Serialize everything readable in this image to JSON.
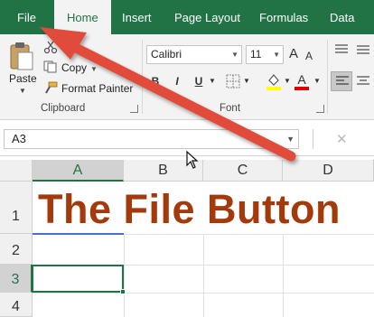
{
  "tabs": {
    "file": "File",
    "home": "Home",
    "insert": "Insert",
    "page_layout": "Page Layout",
    "formulas": "Formulas",
    "data": "Data"
  },
  "clipboard": {
    "paste": "Paste",
    "copy": "Copy",
    "format_painter": "Format Painter",
    "group_label": "Clipboard"
  },
  "font": {
    "name": "Calibri",
    "size": "11",
    "bold": "B",
    "italic": "I",
    "underline": "U",
    "grow": "A",
    "shrink": "A",
    "font_color": "A",
    "group_label": "Font"
  },
  "formula_bar": {
    "name_box": "A3",
    "cancel": "✕"
  },
  "grid": {
    "columns": [
      "A",
      "B",
      "C",
      "D"
    ],
    "rows": [
      "1",
      "2",
      "3",
      "4"
    ],
    "cell_a1": "The File Button"
  },
  "colors": {
    "excel_green": "#217346",
    "title_text": "#a43a0c",
    "annotation_arrow": "#e04b3a"
  }
}
